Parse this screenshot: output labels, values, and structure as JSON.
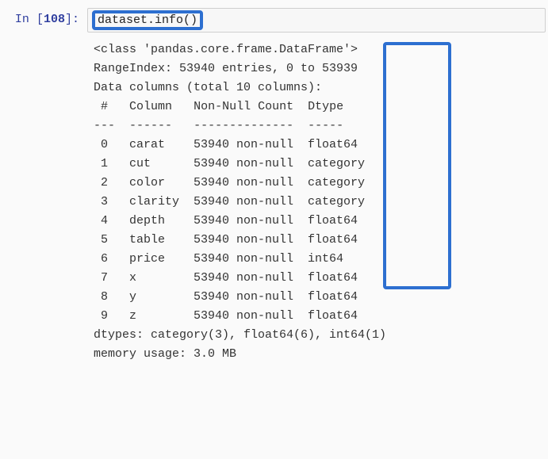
{
  "prompt": {
    "label": "In ",
    "number": "108",
    "suffix": ":"
  },
  "code": "dataset.info()",
  "output": {
    "class_line": "<class 'pandas.core.frame.DataFrame'>",
    "range_line": "RangeIndex: 53940 entries, 0 to 53939",
    "cols_line": "Data columns (total 10 columns):",
    "header_hash": " # ",
    "header_col": "Column ",
    "header_nonnull": "Non-Null Count",
    "header_dtype": "Dtype   ",
    "sep_hash": "---",
    "sep_col": "------ ",
    "sep_nonnull": "--------------",
    "sep_dtype": "-----   ",
    "rows": [
      {
        "idx": " 0 ",
        "col": "carat  ",
        "nn": "53940 non-null",
        "dt": "float64 "
      },
      {
        "idx": " 1 ",
        "col": "cut    ",
        "nn": "53940 non-null",
        "dt": "category"
      },
      {
        "idx": " 2 ",
        "col": "color  ",
        "nn": "53940 non-null",
        "dt": "category"
      },
      {
        "idx": " 3 ",
        "col": "clarity",
        "nn": "53940 non-null",
        "dt": "category"
      },
      {
        "idx": " 4 ",
        "col": "depth  ",
        "nn": "53940 non-null",
        "dt": "float64 "
      },
      {
        "idx": " 5 ",
        "col": "table  ",
        "nn": "53940 non-null",
        "dt": "float64 "
      },
      {
        "idx": " 6 ",
        "col": "price  ",
        "nn": "53940 non-null",
        "dt": "int64   "
      },
      {
        "idx": " 7 ",
        "col": "x      ",
        "nn": "53940 non-null",
        "dt": "float64 "
      },
      {
        "idx": " 8 ",
        "col": "y      ",
        "nn": "53940 non-null",
        "dt": "float64 "
      },
      {
        "idx": " 9 ",
        "col": "z      ",
        "nn": "53940 non-null",
        "dt": "float64 "
      }
    ],
    "dtypes_line": "dtypes: category(3), float64(6), int64(1)",
    "memory_line": "memory usage: 3.0 MB"
  }
}
